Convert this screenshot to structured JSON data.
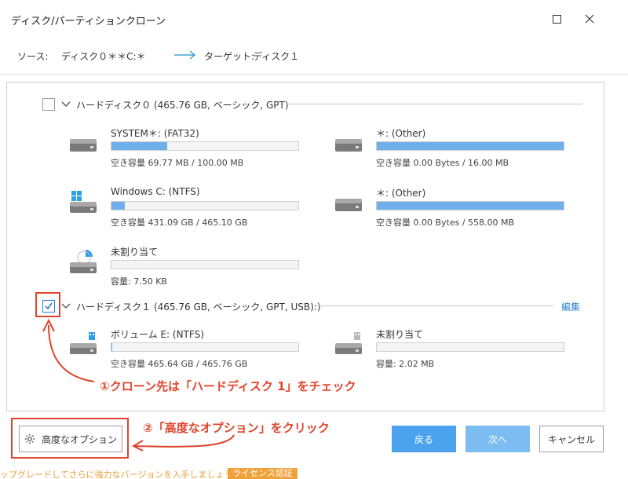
{
  "window": {
    "title": "ディスク/パーティションクローン"
  },
  "source_bar": {
    "source_label": "ソース:",
    "source_value": "ディスク０＊＊C:＊",
    "target_label": "ターゲット:",
    "target_value": "ディスク１"
  },
  "disks": [
    {
      "label": "ハードディスク０ (465.76 GB, ベーシック, GPT)",
      "checked": false,
      "partitions": [
        {
          "name": "SYSTEM＊: (FAT32)",
          "info": "空き容量 69.77 MB / 100.00 MB",
          "used_fraction": 0.3,
          "icon": "drive-icon"
        },
        {
          "name": "＊: (Other)",
          "info": "空き容量 0.00 Bytes / 16.00 MB",
          "used_fraction": 1.0,
          "icon": "drive-icon"
        },
        {
          "name": "Windows C: (NTFS)",
          "info": "空き容量 431.09 GB / 465.10 GB",
          "used_fraction": 0.07,
          "icon": "windows-drive-icon"
        },
        {
          "name": "＊: (Other)",
          "info": "空き容量 0.00 Bytes / 558.00 MB",
          "used_fraction": 1.0,
          "icon": "drive-icon"
        },
        {
          "name": "未割り当て",
          "info": "容量: 7.50 KB",
          "used_fraction": 0,
          "icon": "unallocated-drive-icon"
        }
      ]
    },
    {
      "label": "ハードディスク１ (465.76 GB, ベーシック, GPT, USB):)",
      "checked": true,
      "edit_label": "編集",
      "partitions": [
        {
          "name": "ボリューム E: (NTFS)",
          "info": "空き容量 465.64 GB / 465.76 GB",
          "used_fraction": 0.005,
          "icon": "usb-drive-icon"
        },
        {
          "name": "未割り当て",
          "info": "容量: 2.02 MB",
          "used_fraction": 0,
          "icon": "usb-drive-icon"
        }
      ]
    }
  ],
  "annotations": {
    "step1": "①クローン先は「ハードディスク 1」をチェック",
    "step2": "②「高度なオプション」をクリック"
  },
  "buttons": {
    "advanced": "高度なオプション",
    "back": "戻る",
    "next": "次へ",
    "cancel": "キャンセル"
  },
  "footer": {
    "text": "ップグレードしてさらに強力なバージョンを入手しましょう。",
    "badge": "ライセンス認証"
  },
  "colors": {
    "accent": "#4aa3ec",
    "bar_fill": "#6fb0ec",
    "annotation": "#e0442c"
  }
}
